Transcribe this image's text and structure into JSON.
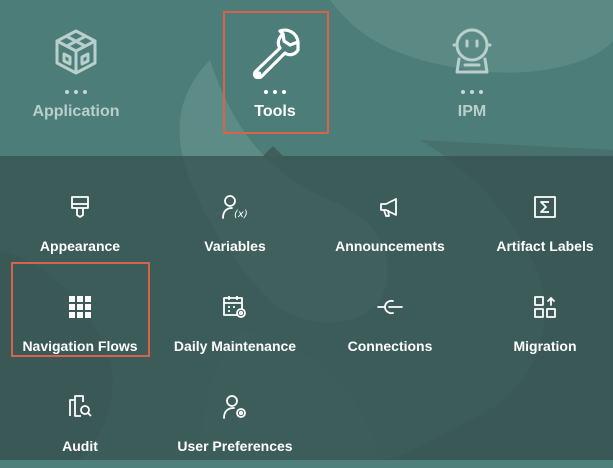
{
  "top_nav": {
    "items": [
      {
        "label": "Application",
        "icon": "cube-icon",
        "active": false
      },
      {
        "label": "Tools",
        "icon": "wrench-icon",
        "active": true
      },
      {
        "label": "IPM",
        "icon": "robot-icon",
        "active": false
      }
    ]
  },
  "tools": {
    "tiles": [
      {
        "label": "Appearance",
        "icon": "paint-brush-icon"
      },
      {
        "label": "Variables",
        "icon": "user-variable-icon"
      },
      {
        "label": "Announcements",
        "icon": "megaphone-icon"
      },
      {
        "label": "Artifact Labels",
        "icon": "sigma-icon"
      },
      {
        "label": "Navigation Flows",
        "icon": "grid-icon"
      },
      {
        "label": "Daily Maintenance",
        "icon": "calendar-gear-icon"
      },
      {
        "label": "Connections",
        "icon": "connection-icon"
      },
      {
        "label": "Migration",
        "icon": "migration-icon"
      },
      {
        "label": "Audit",
        "icon": "audit-icon"
      },
      {
        "label": "User Preferences",
        "icon": "user-gear-icon"
      }
    ]
  },
  "colors": {
    "highlight": "#d9634a",
    "background": "#4f7f7a",
    "panel": "#344f4d"
  }
}
